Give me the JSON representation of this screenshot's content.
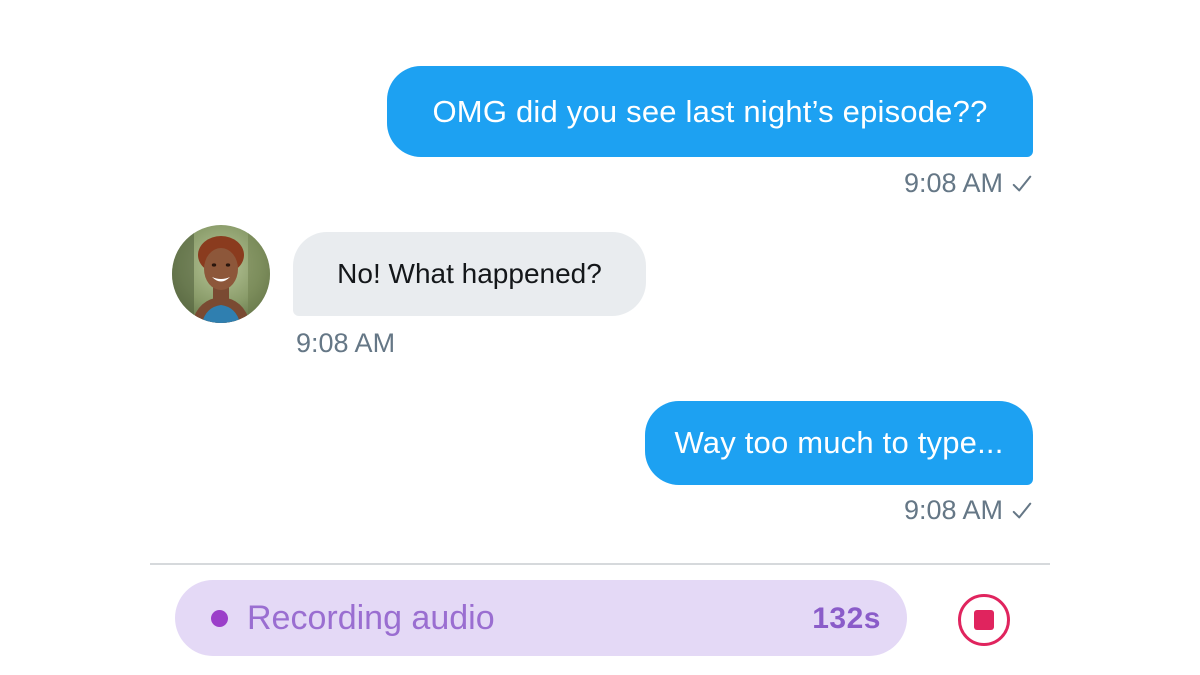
{
  "messages": [
    {
      "direction": "outgoing",
      "text": "OMG did you see last night’s episode??",
      "time": "9:08 AM",
      "status_icon": "check-icon"
    },
    {
      "direction": "incoming",
      "text": "No! What happened?",
      "time": "9:08 AM",
      "avatar_icon": "user-avatar"
    },
    {
      "direction": "outgoing",
      "text": "Way too much to type...",
      "time": "9:08 AM",
      "status_icon": "check-icon"
    }
  ],
  "recording": {
    "label": "Recording audio",
    "duration": "132s",
    "stop_icon": "stop-icon"
  },
  "colors": {
    "outgoing_bubble": "#1da1f2",
    "incoming_bubble": "#e9ecef",
    "recording_bg": "#e4d9f6",
    "recording_accent": "#9b3fc9",
    "stop_red": "#e0245e"
  }
}
